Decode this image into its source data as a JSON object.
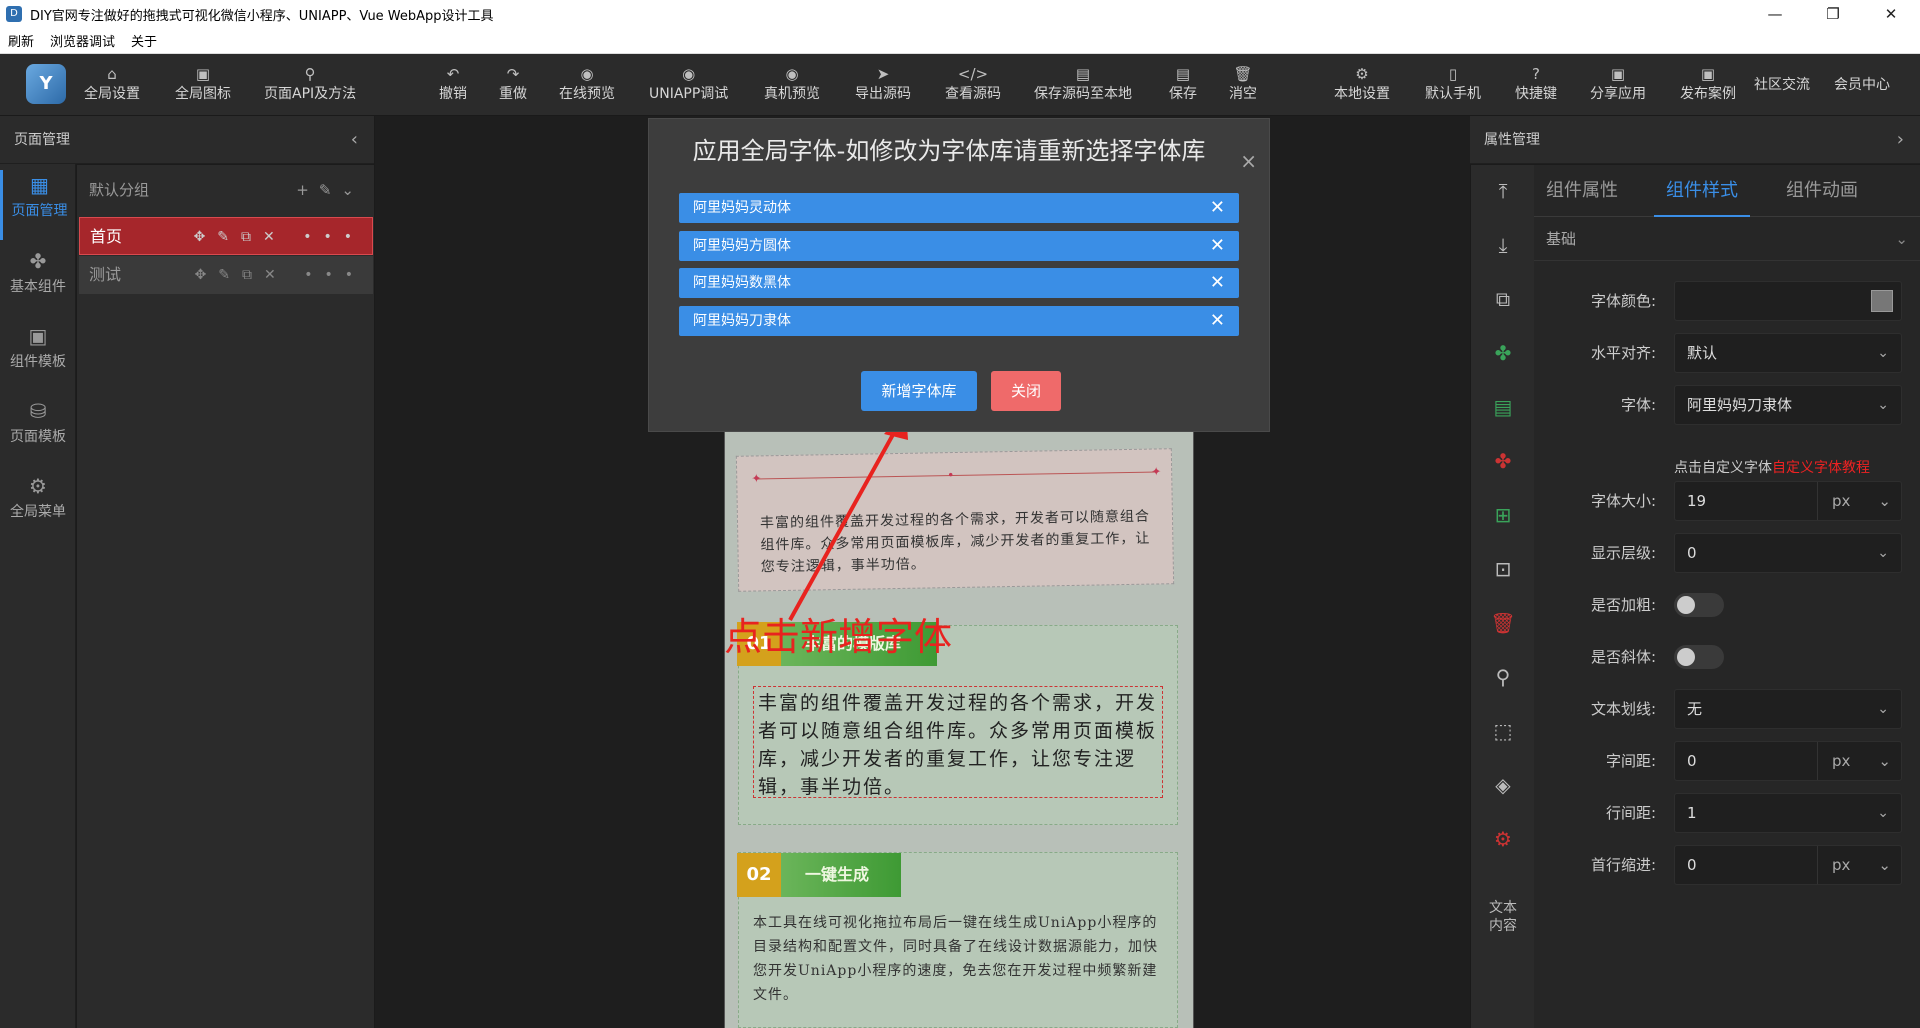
{
  "window": {
    "title": "DIY官网专注做好的拖拽式可视化微信小程序、UNIAPP、Vue WebApp设计工具",
    "icon_letter": "D"
  },
  "menu": [
    "刷新",
    "浏览器调试",
    "关于"
  ],
  "toolbar": {
    "logo": "Y",
    "items": [
      {
        "icon": "⌂",
        "label": "全局设置"
      },
      {
        "icon": "▣",
        "label": "全局图标"
      },
      {
        "icon": "⚲",
        "label": "页面API及方法"
      },
      {
        "icon": "↶",
        "label": "撤销"
      },
      {
        "icon": "↷",
        "label": "重做"
      },
      {
        "icon": "◉",
        "label": "在线预览"
      },
      {
        "icon": "◉",
        "label": "UNIAPP调试"
      },
      {
        "icon": "◉",
        "label": "真机预览"
      },
      {
        "icon": "➤",
        "label": "导出源码"
      },
      {
        "icon": "</>",
        "label": "查看源码"
      },
      {
        "icon": "▤",
        "label": "保存源码至本地"
      },
      {
        "icon": "▤",
        "label": "保存"
      },
      {
        "icon": "🗑",
        "label": "消空"
      },
      {
        "icon": "⚙",
        "label": "本地设置"
      },
      {
        "icon": "▯",
        "label": "默认手机"
      },
      {
        "icon": "?",
        "label": "快捷键"
      },
      {
        "icon": "▣",
        "label": "分享应用"
      },
      {
        "icon": "▣",
        "label": "发布案例"
      }
    ],
    "right_links": [
      "社区交流",
      "会员中心"
    ]
  },
  "left_panel": {
    "title": "页面管理",
    "rail": [
      {
        "icon": "▦",
        "label": "页面管理"
      },
      {
        "icon": "✤",
        "label": "基本组件"
      },
      {
        "icon": "▣",
        "label": "组件模板"
      },
      {
        "icon": "⛁",
        "label": "页面模板"
      },
      {
        "icon": "⚙",
        "label": "全局菜单"
      }
    ],
    "group_name": "默认分组",
    "pages": [
      {
        "name": "首页",
        "active": true
      },
      {
        "name": "测试",
        "active": false
      }
    ],
    "page_tools": "✥✎⧉✕",
    "more": "•••"
  },
  "canvas": {
    "card1_text": "丰富的组件覆盖开发过程的各个需求，开发者可以随意组合组件库。众多常用页面模板库，减少开发者的重复工作，让您专注逻辑，事半功倍。",
    "card2_num": "01",
    "card2_title": "丰富的模版库",
    "card2_text": "丰富的组件覆盖开发过程的各个需求，开发者可以随意组合组件库。众多常用页面模板库，减少开发者的重复工作，让您专注逻辑，事半功倍。",
    "card3_num": "02",
    "card3_title": "一键生成",
    "card3_text": "本工具在线可视化拖拉布局后一键在线生成UniApp小程序的目录结构和配置文件，同时具备了在线设计数据源能力，加快您开发UniApp小程序的速度，免去您在开发过程中频繁新建文件。"
  },
  "annotation": "点击新增字体",
  "dialog": {
    "title": "应用全局字体-如修改为字体库请重新选择字体库",
    "close": "×",
    "fonts": [
      "阿里妈妈灵动体",
      "阿里妈妈方圆体",
      "阿里妈妈数黑体",
      "阿里妈妈刀隶体"
    ],
    "remove_icon": "✕",
    "add_button": "新增字体库",
    "close_button": "关闭"
  },
  "right_panel": {
    "title": "属性管理",
    "rail_labels": [
      "文本",
      "内容"
    ],
    "tabs": [
      "组件属性",
      "组件样式",
      "组件动画"
    ],
    "active_tab": "组件样式",
    "section": "基础",
    "props": {
      "font_color_label": "字体颜色:",
      "align_label": "水平对齐:",
      "align_value": "默认",
      "font_label": "字体:",
      "font_value": "阿里妈妈刀隶体",
      "font_hint": "点击自定义字体",
      "font_hint_link": "自定义字体教程",
      "size_label": "字体大小:",
      "size_value": "19",
      "unit_px": "px",
      "z_label": "显示层级:",
      "z_value": "0",
      "bold_label": "是否加粗:",
      "italic_label": "是否斜体:",
      "deco_label": "文本划线:",
      "deco_value": "无",
      "spacing_label": "字间距:",
      "spacing_value": "0",
      "line_label": "行间距:",
      "line_value": "1",
      "indent_label": "首行缩进:",
      "indent_value": "0"
    }
  },
  "colors": {
    "accent": "#3a8ee6",
    "danger": "#ef6a6a",
    "active_page": "#a6262b",
    "annotation": "#e8231f"
  }
}
